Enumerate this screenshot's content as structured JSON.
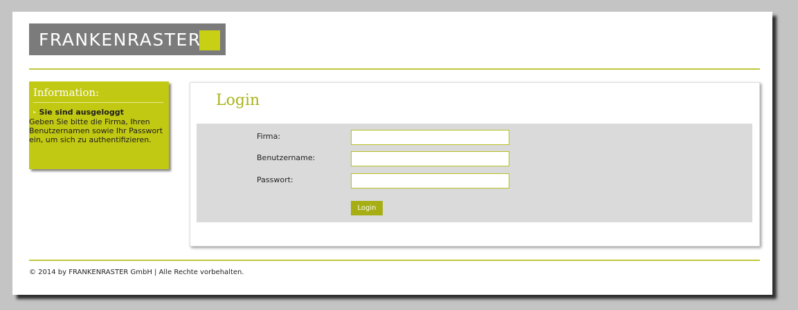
{
  "brand": {
    "logo_text": "FRANKENRASTER",
    "accent_color": "#c8d016",
    "logo_bg": "#7b7b7b"
  },
  "sidebar": {
    "title": "Information:",
    "status_heading": "Sie sind ausgeloggt",
    "message": "Geben Sie bitte die Firma, Ihren Benutzernamen sowie Ihr Passwort ein, um sich zu authentifizieren."
  },
  "login": {
    "title": "Login",
    "fields": {
      "firma": {
        "label": "Firma:",
        "value": "",
        "placeholder": ""
      },
      "benutzername": {
        "label": "Benutzername:",
        "value": "",
        "placeholder": ""
      },
      "passwort": {
        "label": "Passwort:",
        "value": "",
        "placeholder": ""
      }
    },
    "submit_label": "Login"
  },
  "footer": {
    "text": "© 2014 by FRANKENRASTER GmbH | Alle Rechte vorbehalten."
  }
}
